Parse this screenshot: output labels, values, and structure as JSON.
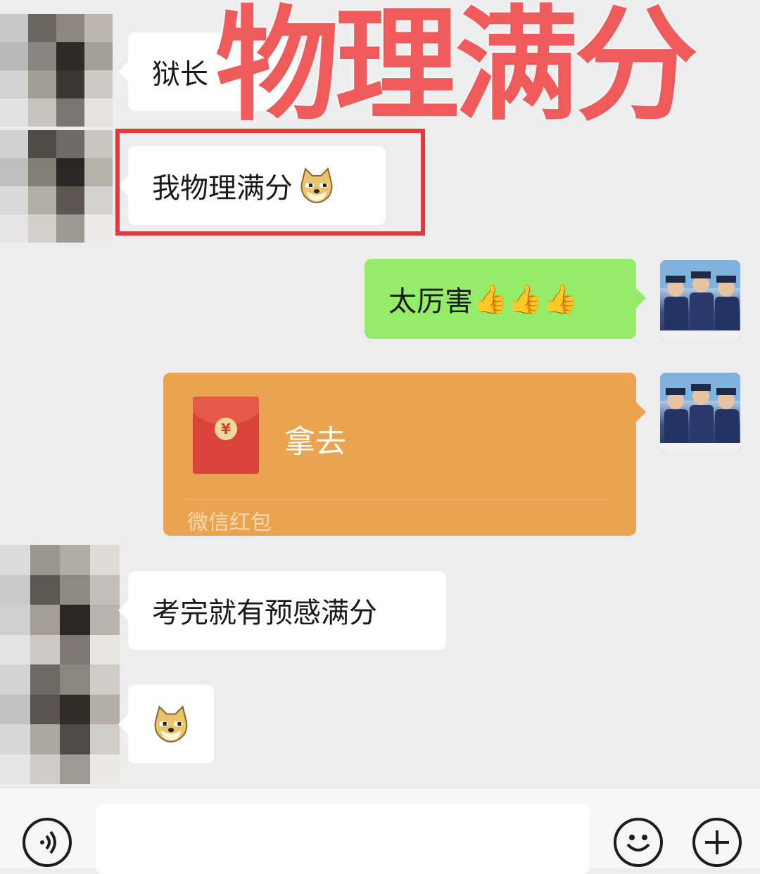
{
  "overlay": {
    "title": "物理满分"
  },
  "messages": {
    "m1": {
      "text": "狱长"
    },
    "m2": {
      "text": "我物理满分",
      "emoji": "doge-emoji"
    },
    "m3": {
      "text": "太厉害",
      "emoji": "thumbs-up-emoji x3"
    },
    "m4": {
      "title": "拿去",
      "footer": "微信红包",
      "icon": "red-packet-icon"
    },
    "m5": {
      "text": "考完就有预感满分"
    },
    "m6": {
      "emoji": "doge-emoji"
    }
  },
  "input_bar": {
    "voice_icon": "voice-icon",
    "emoji_icon": "smiley-icon",
    "more_icon": "plus-icon"
  },
  "colors": {
    "background": "#ededed",
    "incoming_bubble": "#ffffff",
    "outgoing_bubble": "#95ec69",
    "red_packet": "#eaa351",
    "highlight": "#e03a3a",
    "overlay_text": "#ef5a5a"
  }
}
